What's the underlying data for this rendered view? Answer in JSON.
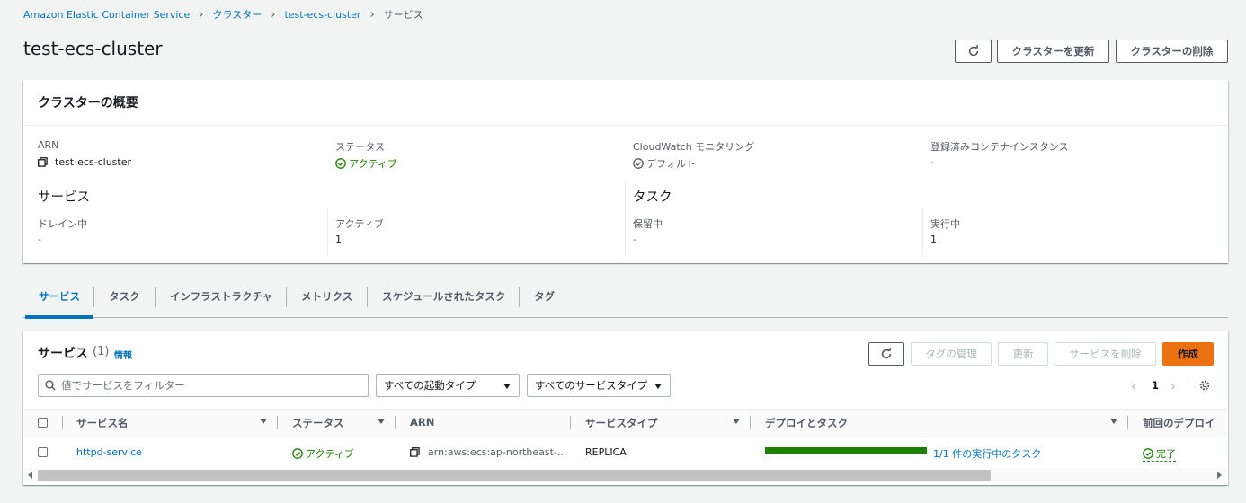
{
  "breadcrumb": {
    "items": [
      "Amazon Elastic Container Service",
      "クラスター",
      "test-ecs-cluster"
    ],
    "current": "サービス"
  },
  "page": {
    "title": "test-ecs-cluster",
    "update_label": "クラスターを更新",
    "delete_label": "クラスターの削除"
  },
  "overview": {
    "title": "クラスターの概要",
    "arn_label": "ARN",
    "arn_value": "test-ecs-cluster",
    "status_label": "ステータス",
    "status_value": "アクティブ",
    "cloudwatch_label": "CloudWatch モニタリング",
    "cloudwatch_value": "デフォルト",
    "instances_label": "登録済みコンテナインスタンス",
    "instances_value": "-",
    "services_heading": "サービス",
    "draining_label": "ドレイン中",
    "draining_value": "-",
    "active_label": "アクティブ",
    "active_value": "1",
    "tasks_heading": "タスク",
    "pending_label": "保留中",
    "pending_value": "-",
    "running_label": "実行中",
    "running_value": "1"
  },
  "tabs": [
    "サービス",
    "タスク",
    "インフラストラクチャ",
    "メトリクス",
    "スケジュールされたタスク",
    "タグ"
  ],
  "services": {
    "title": "サービス",
    "count": "(1)",
    "info_label": "情報",
    "manage_tags_label": "タグの管理",
    "update_label": "更新",
    "delete_label": "サービスを削除",
    "create_label": "作成",
    "filter_placeholder": "値でサービスをフィルター",
    "launch_type_select": "すべての起動タイプ",
    "service_type_select": "すべてのサービスタイプ",
    "page_number": "1",
    "columns": [
      "サービス名",
      "ステータス",
      "ARN",
      "サービスタイプ",
      "デプロイとタスク",
      "前回のデプロイ"
    ],
    "rows": [
      {
        "name": "httpd-service",
        "status": "アクティブ",
        "arn": "arn:aws:ecs:ap-northeast-...",
        "type": "REPLICA",
        "tasks_text": "1/1 件の実行中のタスク",
        "tasks_progress": 1.0,
        "last_deploy": "完了"
      }
    ]
  },
  "colors": {
    "link": "#0073bb",
    "success": "#1d8102",
    "primary": "#ec7211",
    "progress": "#1d8102"
  }
}
